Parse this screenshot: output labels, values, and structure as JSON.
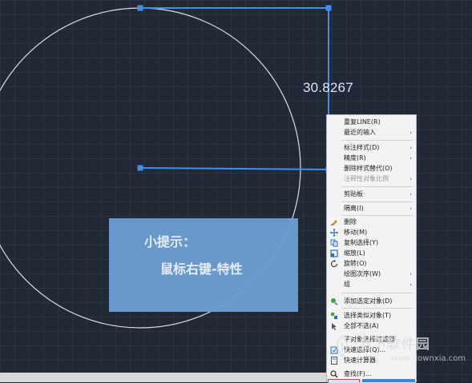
{
  "canvas": {
    "dimension_value": "30.8267",
    "background_color": "#212836",
    "line_color": "#3f8ef4",
    "circle_color": "#d9dde3"
  },
  "tip": {
    "title": "小提示：",
    "body": "鼠标右键-特性"
  },
  "context_menu": {
    "items": [
      {
        "label": "重复LINE(R)",
        "icon": "",
        "submenu": false,
        "disabled": false
      },
      {
        "label": "最近的输入",
        "icon": "",
        "submenu": true,
        "disabled": false
      },
      {
        "label": "标注样式(D)",
        "icon": "",
        "submenu": true,
        "disabled": false
      },
      {
        "label": "精度(R)",
        "icon": "",
        "submenu": true,
        "disabled": false
      },
      {
        "label": "删除样式替代(O)",
        "icon": "",
        "submenu": false,
        "disabled": false
      },
      {
        "label": "注释性对象比例",
        "icon": "",
        "submenu": true,
        "disabled": true
      },
      {
        "label": "剪贴板",
        "icon": "",
        "submenu": true,
        "disabled": false
      },
      {
        "label": "隔离(I)",
        "icon": "",
        "submenu": true,
        "disabled": false
      },
      {
        "label": "删除",
        "icon": "eraser-icon",
        "submenu": false,
        "disabled": false
      },
      {
        "label": "移动(M)",
        "icon": "move-icon",
        "submenu": false,
        "disabled": false
      },
      {
        "label": "复制选择(Y)",
        "icon": "copy-icon",
        "submenu": false,
        "disabled": false
      },
      {
        "label": "缩放(L)",
        "icon": "scale-icon",
        "submenu": false,
        "disabled": false
      },
      {
        "label": "旋转(O)",
        "icon": "rotate-icon",
        "submenu": false,
        "disabled": false
      },
      {
        "label": "绘图次序(W)",
        "icon": "",
        "submenu": true,
        "disabled": false
      },
      {
        "label": "组",
        "icon": "",
        "submenu": true,
        "disabled": false
      },
      {
        "label": "添加选定对象(D)",
        "icon": "add-selected-icon",
        "submenu": false,
        "disabled": false
      },
      {
        "label": "选择类似对象(T)",
        "icon": "select-similar-icon",
        "submenu": false,
        "disabled": false
      },
      {
        "label": "全部不选(A)",
        "icon": "deselect-icon",
        "submenu": false,
        "disabled": false
      },
      {
        "label": "子对象选择过滤器",
        "icon": "",
        "submenu": true,
        "disabled": false
      },
      {
        "label": "快速选择(Q)...",
        "icon": "quick-select-icon",
        "submenu": false,
        "disabled": false
      },
      {
        "label": "快速计算器",
        "icon": "calculator-icon",
        "submenu": false,
        "disabled": false
      },
      {
        "label": "查找(F)...",
        "icon": "find-icon",
        "submenu": false,
        "disabled": false
      }
    ]
  },
  "watermark": {
    "name": "当下软件园",
    "url": "www.downxia.com"
  }
}
